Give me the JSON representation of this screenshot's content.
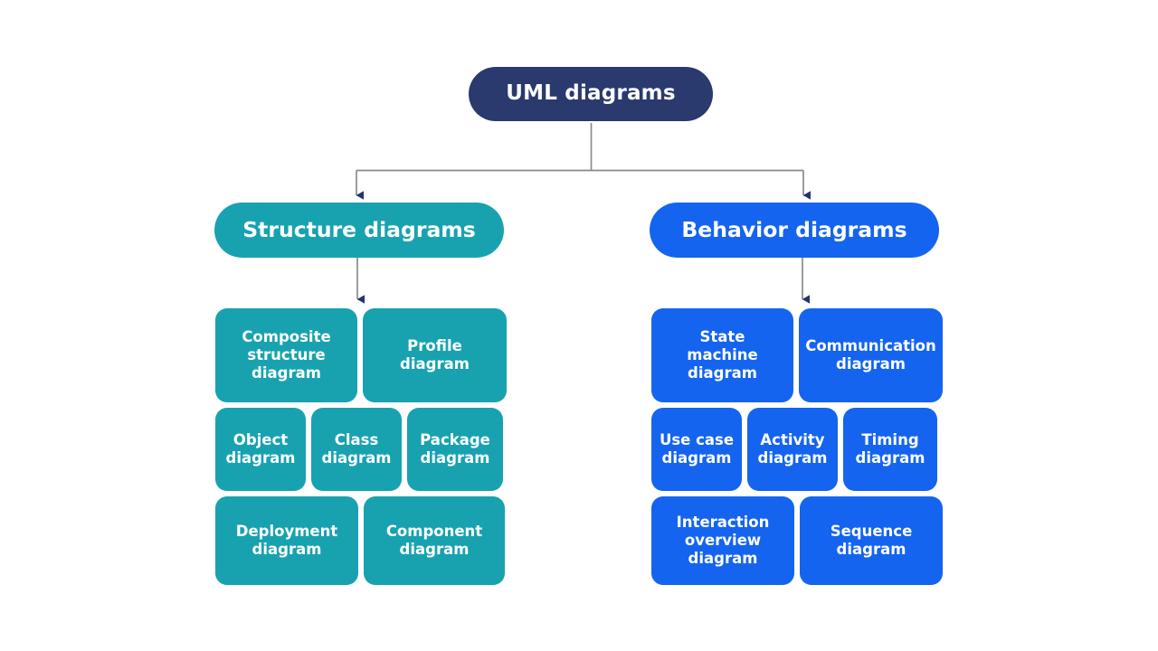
{
  "chart_data": {
    "type": "diagram",
    "title": "UML diagrams",
    "subtype": "hierarchy-tree",
    "orientation": "top-down",
    "levels": 3,
    "colors": {
      "root": "#2a3a6e",
      "structure_branch": "#18a2b0",
      "behavior_branch": "#1464f0",
      "connector_line": "#808080",
      "arrowhead": "#22356b",
      "label_text": "#ffffff",
      "background": "#ffffff"
    },
    "nodes": {
      "root": "UML diagrams",
      "branches": [
        {
          "label": "Structure diagrams",
          "color": "#18a2b0",
          "children": [
            "Composite structure diagram",
            "Profile diagram",
            "Object diagram",
            "Class diagram",
            "Package diagram",
            "Deployment diagram",
            "Component diagram"
          ]
        },
        {
          "label": "Behavior diagrams",
          "color": "#1464f0",
          "children": [
            "State machine diagram",
            "Communication diagram",
            "Use case diagram",
            "Activity diagram",
            "Timing diagram",
            "Interaction overview diagram",
            "Sequence diagram"
          ]
        }
      ]
    }
  },
  "root": {
    "label": "UML diagrams"
  },
  "structure": {
    "label": "Structure diagrams",
    "rows": [
      [
        {
          "label": "Composite\nstructure\ndiagram"
        },
        {
          "label": "Profile\ndiagram"
        }
      ],
      [
        {
          "label": "Object\ndiagram"
        },
        {
          "label": "Class\ndiagram"
        },
        {
          "label": "Package\ndiagram"
        }
      ],
      [
        {
          "label": "Deployment\ndiagram"
        },
        {
          "label": "Component\ndiagram"
        }
      ]
    ]
  },
  "behavior": {
    "label": "Behavior diagrams",
    "rows": [
      [
        {
          "label": "State\nmachine\ndiagram"
        },
        {
          "label": "Communication\ndiagram"
        }
      ],
      [
        {
          "label": "Use case\ndiagram"
        },
        {
          "label": "Activity\ndiagram"
        },
        {
          "label": "Timing\ndiagram"
        }
      ],
      [
        {
          "label": "Interaction\noverview\ndiagram"
        },
        {
          "label": "Sequence\ndiagram"
        }
      ]
    ]
  }
}
